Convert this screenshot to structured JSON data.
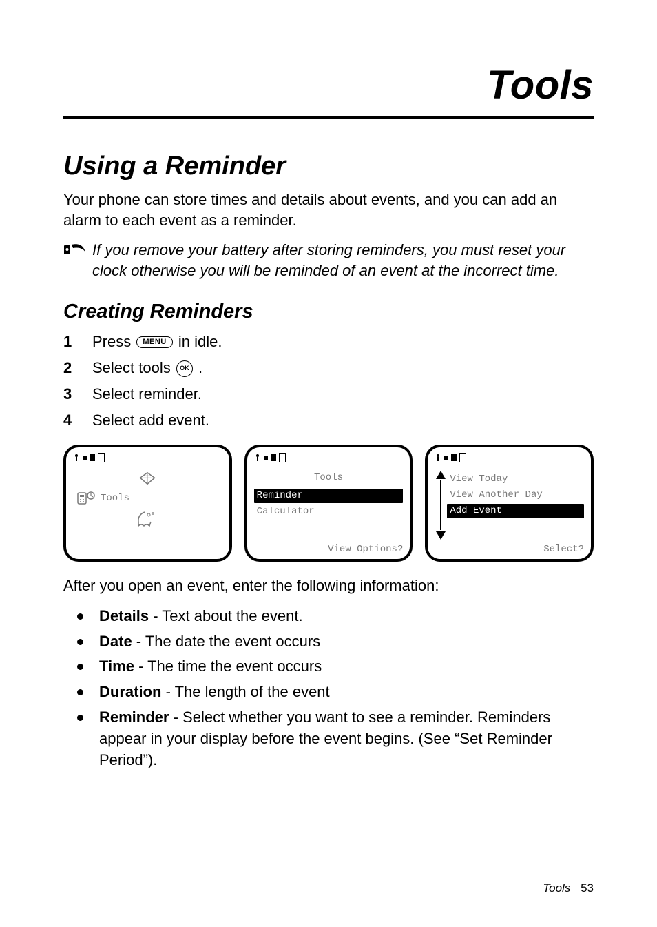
{
  "chapter_title": "Tools",
  "section_title": "Using a Reminder",
  "intro": "Your phone can store times and details about events, and you can add an alarm to each event as a reminder.",
  "note": "If you remove your battery after storing reminders, you must reset your clock otherwise you will be reminded of an event at the incorrect time.",
  "sub_title": "Creating Reminders",
  "steps": {
    "s1a": "Press ",
    "s1_key": "MENU",
    "s1b": " in idle.",
    "s2a": "Select tools ",
    "s2_key": "OK",
    "s2b": ".",
    "s3": "Select reminder.",
    "s4": "Select add event."
  },
  "screen1": {
    "tools_label": "Tools"
  },
  "screen2": {
    "title": "Tools",
    "items": [
      "Reminder",
      "Calculator"
    ],
    "selected": 0,
    "softkey": "View Options?"
  },
  "screen3": {
    "items": [
      "View Today",
      "View Another Day",
      "Add Event"
    ],
    "selected": 2,
    "softkey": "Select?"
  },
  "after_text": "After you open an event, enter the following information:",
  "bullets": [
    {
      "term": "Details",
      "desc": " - Text about the event."
    },
    {
      "term": "Date",
      "desc": " - The date the event occurs"
    },
    {
      "term": "Time",
      "desc": " - The time the event occurs"
    },
    {
      "term": "Duration",
      "desc": " - The length of the event"
    },
    {
      "term": "Reminder",
      "desc": " - Select whether you want to see a reminder. Reminders appear in your display before the event begins. (See “Set Reminder Period”)."
    }
  ],
  "footer": {
    "label": "Tools",
    "page": "53"
  }
}
